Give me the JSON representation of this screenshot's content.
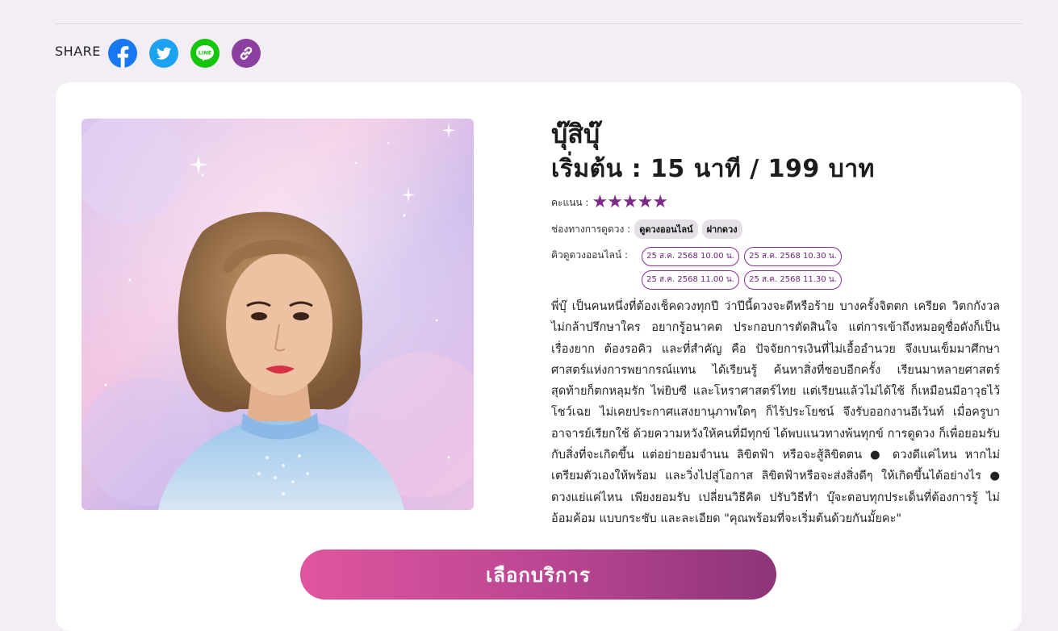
{
  "share": {
    "label": "SHARE",
    "icons": [
      "facebook-icon",
      "twitter-icon",
      "line-icon",
      "link-icon"
    ],
    "line_text": "LINE"
  },
  "profile": {
    "name": "บุ๊สิบุ๊",
    "price": "เริ่มต้น : 15 นาที / 199 บาท",
    "rating_label": "คะแนน :",
    "rating": 5,
    "stars": "★★★★★",
    "channel_label": "ช่องทางการดูดวง :",
    "channels": [
      "ดูดวงออนไลน์",
      "ฝากดวง"
    ],
    "queue_label": "คิวดูดวงออนไลน์ :",
    "slots": [
      "25 ส.ค. 2568 10.00 น.",
      "25 ส.ค. 2568 10.30 น.",
      "25 ส.ค. 2568 11.00 น.",
      "25 ส.ค. 2568 11.30 น."
    ],
    "description": "พี่บุ๊ เป็นคนหนึ่งที่ต้องเช็คดวงทุกปี ว่าปีนี้ดวงจะดีหรือร้าย บางครั้งจิตตก เครียด วิตกกังวล ไม่กล้าปรึกษาใคร อยากรู้อนาคต ประกอบการตัดสินใจ แต่การเข้าถึงหมอดูชื่อดังก็เป็นเรื่องยาก ต้องรอคิว และที่สำคัญ คือ ปัจจัยการเงินที่ไม่เอื้ออำนวย จึงเบนเข็มมาศึกษาศาสตร์แห่งการพยากรณ์แทน ได้เรียนรู้ ค้นหาสิ่งที่ชอบอีกครั้ง เรียนมาหลายศาสตร์ สุดท้ายก็ตกหลุมรัก ไพ่ยิบซี และโหราศาสตร์ไทย แต่เรียนแล้วไม่ได้ใช้ ก็เหมือนมีอาวุธไว้โชว์เฉย ไม่เคยประกาศแสงยานุภาพใดๆ ก็ไร้ประโยชน์ จึงรับออกงานอีเว้นท์ เมื่อครูบาอาจารย์เรียกใช้ ด้วยความหวังให้คนที่มีทุกข์ ได้พบแนวทางพ้นทุกข์ การดูดวง ก็เพื่อยอมรับกับสิ่งที่จะเกิดขึ้น แต่อย่ายอมจำนน ลิขิตฟ้า หรือจะสู้ลิขิตตน ● ดวงดีแค่ไหน หากไม่เตรียมตัวเองให้พร้อม และวิ่งไปสู่โอกาส ลิขิตฟ้าหรือจะส่งสิ่งดีๆ ให้เกิดขึ้นได้อย่างไร ● ดวงแย่แค่ไหน เพียงยอมรับ เปลี่ยนวิธีคิด ปรับวิธีทำ บุ๊จะตอบทุกประเด็นที่ต้องการรู้ ไม่อ้อมค้อม แบบกระชับ และละเอียด \"คุณพร้อมที่จะเริ่มต้นด้วยกันมั้ยคะ\""
  },
  "cta": {
    "label": "เลือกบริการ"
  },
  "colors": {
    "accent": "#7e2a8a",
    "button_start": "#e0559f",
    "button_end": "#8d3478",
    "background": "#f3eef6"
  }
}
